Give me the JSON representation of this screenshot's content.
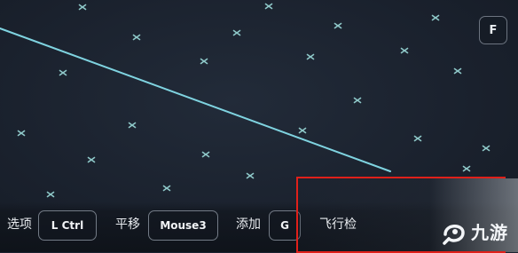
{
  "corner_key": {
    "label": "F"
  },
  "controls": [
    {
      "action": "选项",
      "key": "L Ctrl"
    },
    {
      "action": "平移",
      "key": "Mouse3"
    },
    {
      "action": "添加",
      "key": "G"
    },
    {
      "action": "飞行检"
    }
  ],
  "watermark": {
    "text": "九游"
  },
  "colors": {
    "background": "#1b2330",
    "route_line": "#7fd3e0",
    "waypoint": "#8fc9c9",
    "highlight": "#e0201a"
  }
}
